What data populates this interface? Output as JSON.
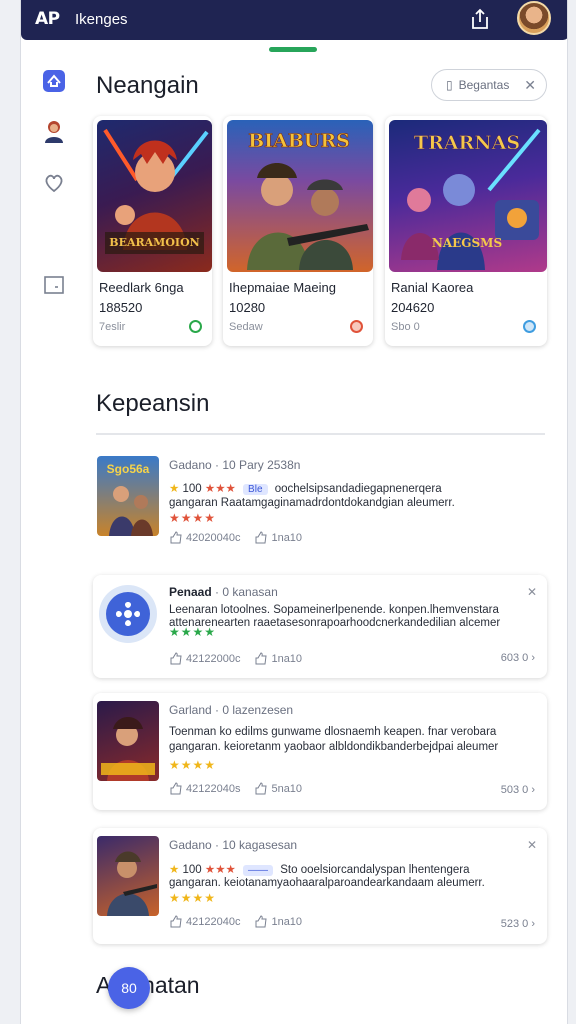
{
  "app": {
    "logo": "AP",
    "title": "Ikenges"
  },
  "colors": {
    "topbar": "#1f2452",
    "accent": "#4a63e6",
    "handle": "#27a55a"
  },
  "nav": [
    {
      "name": "home-icon"
    },
    {
      "name": "avatar-nav-icon"
    },
    {
      "name": "heart-icon"
    },
    {
      "name": "library-icon"
    }
  ],
  "featured": {
    "title": "Neangain",
    "filter_label": "Begantas",
    "cards": [
      {
        "title": "Reedlark 6nga",
        "number": "188520",
        "meta": "7eslir",
        "art_text": "BEARAMOION",
        "status_color": "#2aa84a"
      },
      {
        "title": "Ihepmaiae Maeing",
        "number": "10280",
        "meta": "Sedaw",
        "art_text": "BIABURS",
        "status_color": "#e0533a"
      },
      {
        "title": "Ranial Kaorea",
        "number": "204620",
        "meta": "Sbo 0",
        "art_text": "NAEGSMS",
        "status_color": "#3f9de0"
      }
    ]
  },
  "reviews_section": {
    "title": "Kepeansin"
  },
  "reviews": [
    {
      "author": "Gadano",
      "date": "· 10 Pary 2538n",
      "rating_text": "100",
      "badge": "Ble",
      "line1": "oochelsipsandadiegapnenerqera",
      "line2": "gangaran Raatamgaginamadrdontdokandgian aleumerr.",
      "stars": "★★★★",
      "likes": "42020040c",
      "replies": "1na10",
      "right": "",
      "corner": "",
      "thumb_text": "Sgo56a"
    },
    {
      "author": "Penaad",
      "date": "· 0 kanasan",
      "rating_text": "",
      "badge": "",
      "line1": "Leenaran lotoolnes. Sopameinerlpenende. konpen.lhemvenstara",
      "line2": "attenarenearten raaetasesonrapoarhoodcnerkandedilian alcemer",
      "stars": "★★★★",
      "likes": "42122000c",
      "replies": "1na10",
      "right": "603 0",
      "corner": "✕",
      "thumb_text": ""
    },
    {
      "author": "Garland",
      "date": "· 0 lazenzesen",
      "rating_text": "",
      "badge": "",
      "line1": "Toenman ko edilms gunwame dlosnaemh keapen. fnar verobara",
      "line2": "gangaran. keioretanm yaobaor albldondikbanderbejdpai aleumer",
      "stars": "★★★★",
      "likes": "42122040s",
      "replies": "5na10",
      "right": "503 0",
      "corner": "",
      "thumb_text": ""
    },
    {
      "author": "Gadano",
      "date": "· 10 kagasesan",
      "rating_text": "100",
      "badge": "——",
      "line1": "Sto ooelsiorcandalyspan lhentengera",
      "line2": "gangaran. keiotanamyaohaaralparoandearkandaam aleumerr.",
      "stars": "★★★★",
      "likes": "42122040c",
      "replies": "1na10",
      "right": "523 0",
      "corner": "✕",
      "thumb_text": ""
    }
  ],
  "footer": {
    "title": "A panatan",
    "fab_label": "80"
  }
}
